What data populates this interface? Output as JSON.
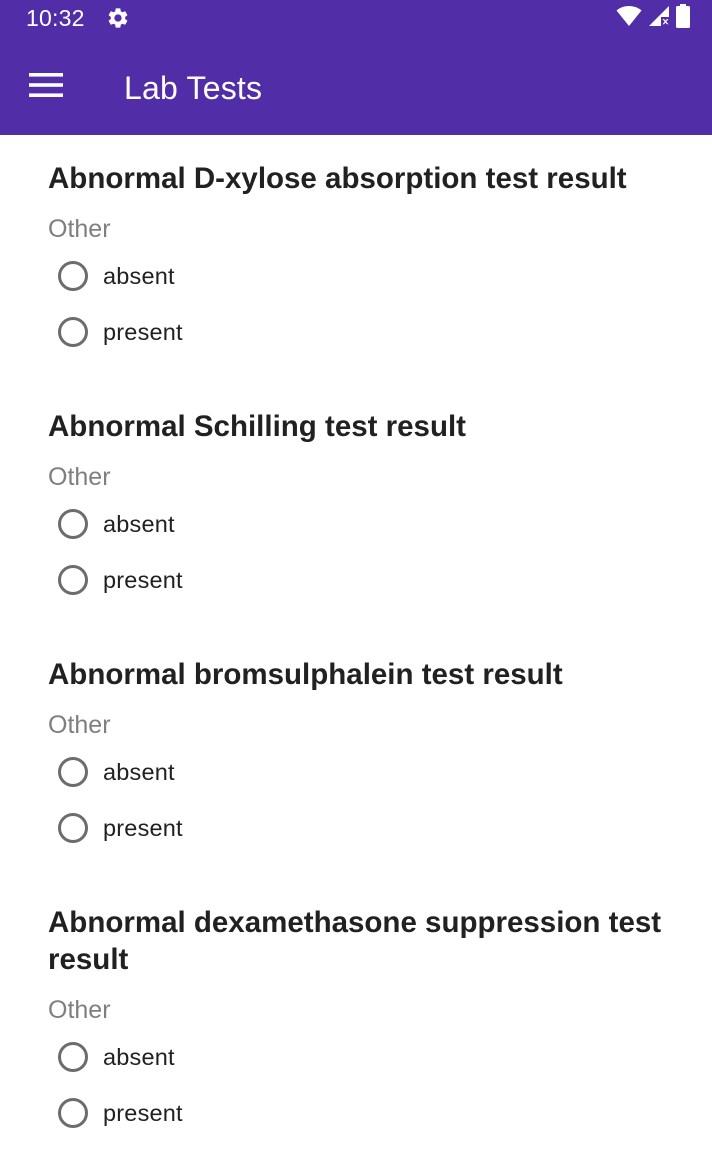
{
  "status_bar": {
    "time": "10:32",
    "icons": [
      "settings-gear-icon",
      "wifi-icon",
      "cell-signal-icon",
      "battery-icon"
    ]
  },
  "app_bar": {
    "menu_icon": "hamburger-menu-icon",
    "title": "Lab Tests"
  },
  "colors": {
    "primary": "#512da8",
    "background": "#ffffff",
    "title_text": "#212121",
    "category_text": "#7f7f7f",
    "radio_outline": "#6c6c6c"
  },
  "questions": [
    {
      "title": "Abnormal D-xylose absorption test result",
      "category": "Other",
      "options": [
        {
          "label": "absent",
          "selected": false
        },
        {
          "label": "present",
          "selected": false
        }
      ]
    },
    {
      "title": "Abnormal Schilling test result",
      "category": "Other",
      "options": [
        {
          "label": "absent",
          "selected": false
        },
        {
          "label": "present",
          "selected": false
        }
      ]
    },
    {
      "title": "Abnormal bromsulphalein test result",
      "category": "Other",
      "options": [
        {
          "label": "absent",
          "selected": false
        },
        {
          "label": "present",
          "selected": false
        }
      ]
    },
    {
      "title": "Abnormal dexamethasone suppression test result",
      "category": "Other",
      "options": [
        {
          "label": "absent",
          "selected": false
        },
        {
          "label": "present",
          "selected": false
        }
      ]
    }
  ]
}
